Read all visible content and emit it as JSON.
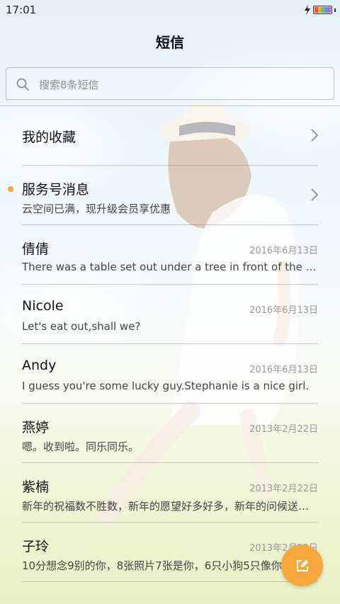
{
  "status": {
    "time": "17:01"
  },
  "header": {
    "title": "短信"
  },
  "search": {
    "placeholder": "搜索8条短信"
  },
  "favorites": {
    "label": "我的收藏"
  },
  "service": {
    "title": "服务号消息",
    "preview": "云空间已满，现升级会员享优惠"
  },
  "threads": [
    {
      "name": "倩倩",
      "preview": "There was a table set out under a tree in front of the house, and the March Hare and the Hatter were having tea at it",
      "date": "2016年6月13日"
    },
    {
      "name": "Nicole",
      "preview": "Let's eat out,shall we?",
      "date": "2016年6月13日"
    },
    {
      "name": "Andy",
      "preview": "I guess you're some lucky guy.Stephanie is a nice girl.",
      "date": "2016年6月13日"
    },
    {
      "name": "燕婷",
      "preview": "嗯。收到啦。同乐同乐。",
      "date": "2013年2月22日"
    },
    {
      "name": "紫楠",
      "preview": "新年的祝福数不胜数，新年的愿望好多好多，新年的问候送给你",
      "date": "2013年2月22日"
    },
    {
      "name": "子玲",
      "preview": "10分想念9别的你，8张照片7张是你，6只小狗5只像你",
      "date": "2013年2月22日"
    }
  ],
  "colors": {
    "accent": "#f7a83c",
    "unread_dot": "#f5a83a"
  },
  "icons": {
    "search": "search-icon",
    "chevron": "chevron-right-icon",
    "compose": "compose-icon",
    "battery": "battery-icon",
    "charging": "charging-icon"
  }
}
